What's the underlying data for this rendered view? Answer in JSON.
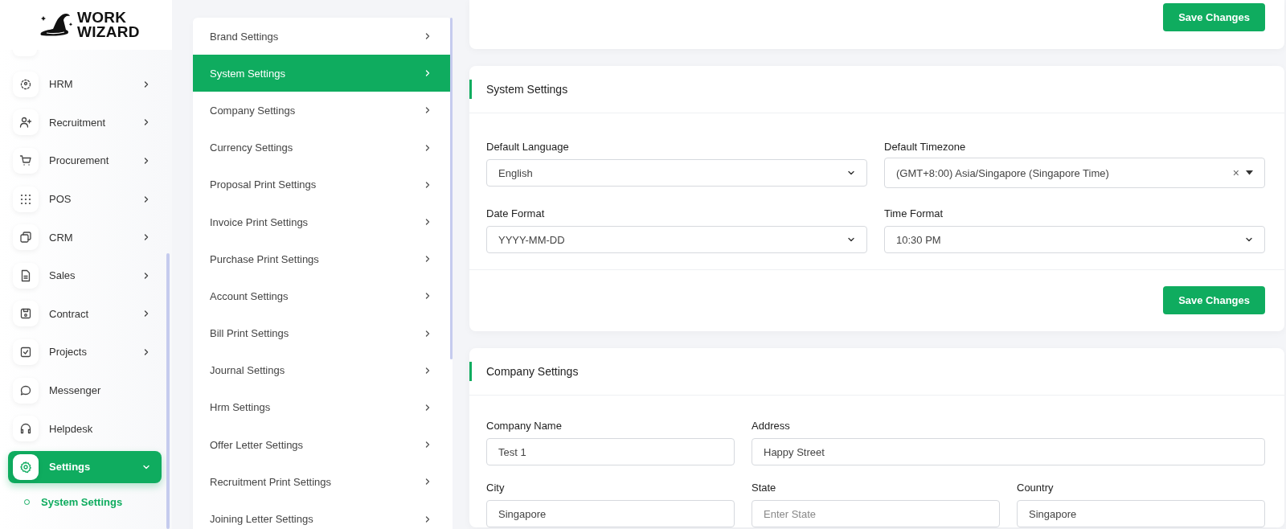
{
  "logo": {
    "line_1": "WORK",
    "line_2": "WIZARD"
  },
  "sidebar": {
    "items": [
      {
        "label": "HRM",
        "kind": "group",
        "expanded": false,
        "selected": false
      },
      {
        "label": "Recruitment",
        "kind": "group",
        "expanded": false,
        "selected": false
      },
      {
        "label": "Procurement",
        "kind": "group",
        "expanded": false,
        "selected": false
      },
      {
        "label": "POS",
        "kind": "group",
        "expanded": false,
        "selected": false
      },
      {
        "label": "CRM",
        "kind": "group",
        "expanded": false,
        "selected": false
      },
      {
        "label": "Sales",
        "kind": "group",
        "expanded": false,
        "selected": false
      },
      {
        "label": "Contract",
        "kind": "group",
        "expanded": false,
        "selected": false
      },
      {
        "label": "Projects",
        "kind": "group",
        "expanded": false,
        "selected": false
      },
      {
        "label": "Messenger",
        "kind": "link",
        "selected": false
      },
      {
        "label": "Helpdesk",
        "kind": "link",
        "selected": false
      },
      {
        "label": "Settings",
        "kind": "group",
        "expanded": true,
        "selected": true,
        "children": [
          {
            "label": "System Settings",
            "selected": true
          }
        ]
      }
    ]
  },
  "settings_menu": {
    "items": [
      {
        "label": "Brand Settings",
        "selected": false
      },
      {
        "label": "System Settings",
        "selected": true
      },
      {
        "label": "Company Settings",
        "selected": false
      },
      {
        "label": "Currency Settings",
        "selected": false
      },
      {
        "label": "Proposal Print Settings",
        "selected": false
      },
      {
        "label": "Invoice Print Settings",
        "selected": false
      },
      {
        "label": "Purchase Print Settings",
        "selected": false
      },
      {
        "label": "Account Settings",
        "selected": false
      },
      {
        "label": "Bill Print Settings",
        "selected": false
      },
      {
        "label": "Journal Settings",
        "selected": false
      },
      {
        "label": "Hrm Settings",
        "selected": false
      },
      {
        "label": "Offer Letter Settings",
        "selected": false
      },
      {
        "label": "Recruitment Print Settings",
        "selected": false
      },
      {
        "label": "Joining Letter Settings",
        "selected": false
      }
    ]
  },
  "cards": [
    {
      "kind": "footer",
      "button": "Save Changes"
    },
    {
      "kind": "system",
      "title": "System Settings",
      "button": "Save Changes",
      "rows": [
        [
          {
            "label": "Default Language",
            "kind": "select",
            "value": "English"
          },
          {
            "label": "Default Timezone",
            "kind": "select_clear",
            "value": "(GMT+8:00) Asia/Singapore (Singapore Time)",
            "clear": "×"
          }
        ],
        [
          {
            "label": "Date Format",
            "kind": "select",
            "value": "YYYY-MM-DD"
          },
          {
            "label": "Time Format",
            "kind": "select",
            "value": "10:30 PM"
          }
        ]
      ]
    },
    {
      "kind": "company",
      "title": "Company Settings",
      "rows": [
        [
          {
            "label": "Company Name",
            "kind": "text",
            "value": "Test 1"
          },
          {
            "label": "Address",
            "kind": "text",
            "value": "Happy Street"
          }
        ],
        [
          {
            "label": "City",
            "kind": "text",
            "value": "Singapore"
          },
          {
            "label": "State",
            "kind": "text",
            "placeholder": "Enter State"
          },
          {
            "label": "Country",
            "kind": "text",
            "value": "Singapore"
          }
        ]
      ]
    }
  ]
}
